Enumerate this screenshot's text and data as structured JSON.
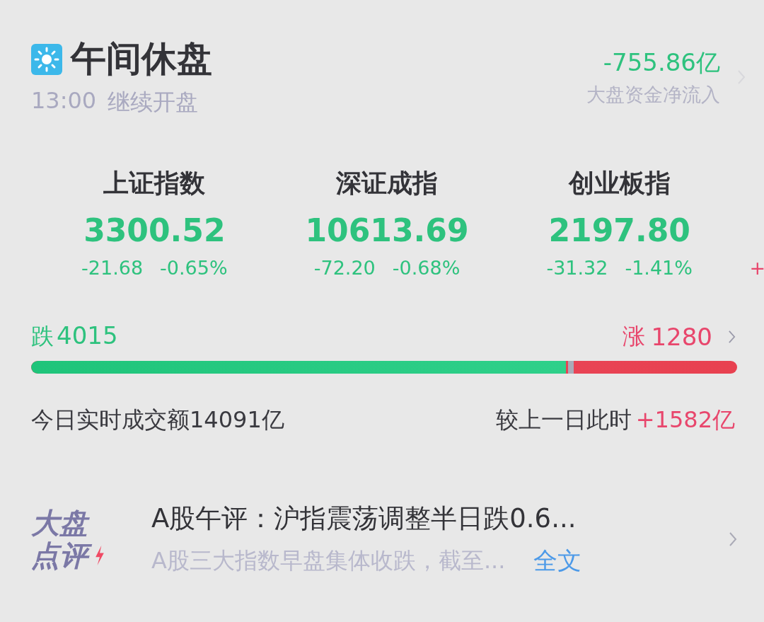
{
  "header": {
    "title": "午间休盘",
    "subtitle_time": "13:00",
    "subtitle_text": "继续开盘",
    "flow_value": "-755.86亿",
    "flow_label": "大盘资金净流入"
  },
  "indices": [
    {
      "name": "上证指数",
      "value": "3300.52",
      "change": "-21.68",
      "percent": "-0.65%"
    },
    {
      "name": "深证成指",
      "value": "10613.69",
      "change": "-72.20",
      "percent": "-0.68%"
    },
    {
      "name": "创业板指",
      "value": "2197.80",
      "change": "-31.32",
      "percent": "-1.41%"
    }
  ],
  "next_index_change": "+",
  "breadth": {
    "down_label": "跌",
    "down_count": "4015",
    "up_label": "涨",
    "up_count": "1280",
    "level": 0.758
  },
  "turnover": {
    "label": "今日实时成交额14091亿",
    "compare_label": "较上一日此时",
    "compare_value": "+1582亿"
  },
  "commentary": {
    "logo_top": "大盘",
    "logo_bottom": "点评",
    "headline": "A股午评：沪指震荡调整半日跌0.6...",
    "summary": "A股三大指数早盘集体收跌，截至...",
    "link": "全文"
  }
}
